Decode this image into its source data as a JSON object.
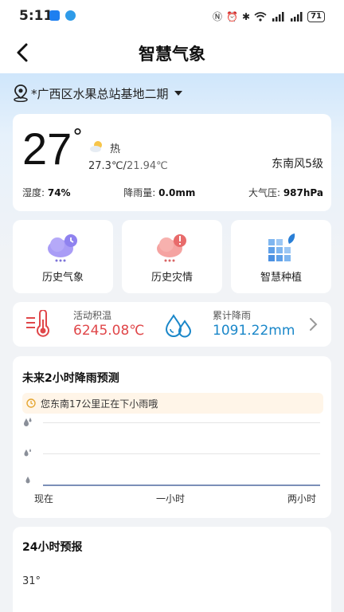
{
  "status_bar": {
    "time": "5:11",
    "battery": "71"
  },
  "header": {
    "title": "智慧气象"
  },
  "location": {
    "name": "*广西区水果总站基地二期"
  },
  "weather": {
    "temp": "27",
    "degree": "°",
    "condition": "热",
    "high": "27.3℃/",
    "low": "21.94℃",
    "wind": "东南风5级",
    "humidity_label": "湿度: ",
    "humidity": "74%",
    "rain_label": "降雨量: ",
    "rain": "0.0mm",
    "pressure_label": "大气压: ",
    "pressure": "987hPa"
  },
  "quick": [
    {
      "label": "历史气象",
      "icon": "history-weather-icon"
    },
    {
      "label": "历史灾情",
      "icon": "disaster-alert-icon"
    },
    {
      "label": "智慧种植",
      "icon": "smart-planting-icon"
    }
  ],
  "stats": {
    "accum_temp_label": "活动积温",
    "accum_temp": "6245.08℃",
    "accum_rain_label": "累计降雨",
    "accum_rain": "1091.22mm"
  },
  "rain_forecast": {
    "title": "未来2小时降雨预测",
    "alert": "您东南17公里正在下小雨哦",
    "x_labels": [
      "现在",
      "一小时",
      "两小时"
    ]
  },
  "forecast24": {
    "title": "24小时预报",
    "top_temp": "31°"
  },
  "colors": {
    "accent_red": "#e0474a",
    "accent_blue": "#1a87c9",
    "purple": "#9a8df2",
    "pink": "#f08c8c"
  }
}
